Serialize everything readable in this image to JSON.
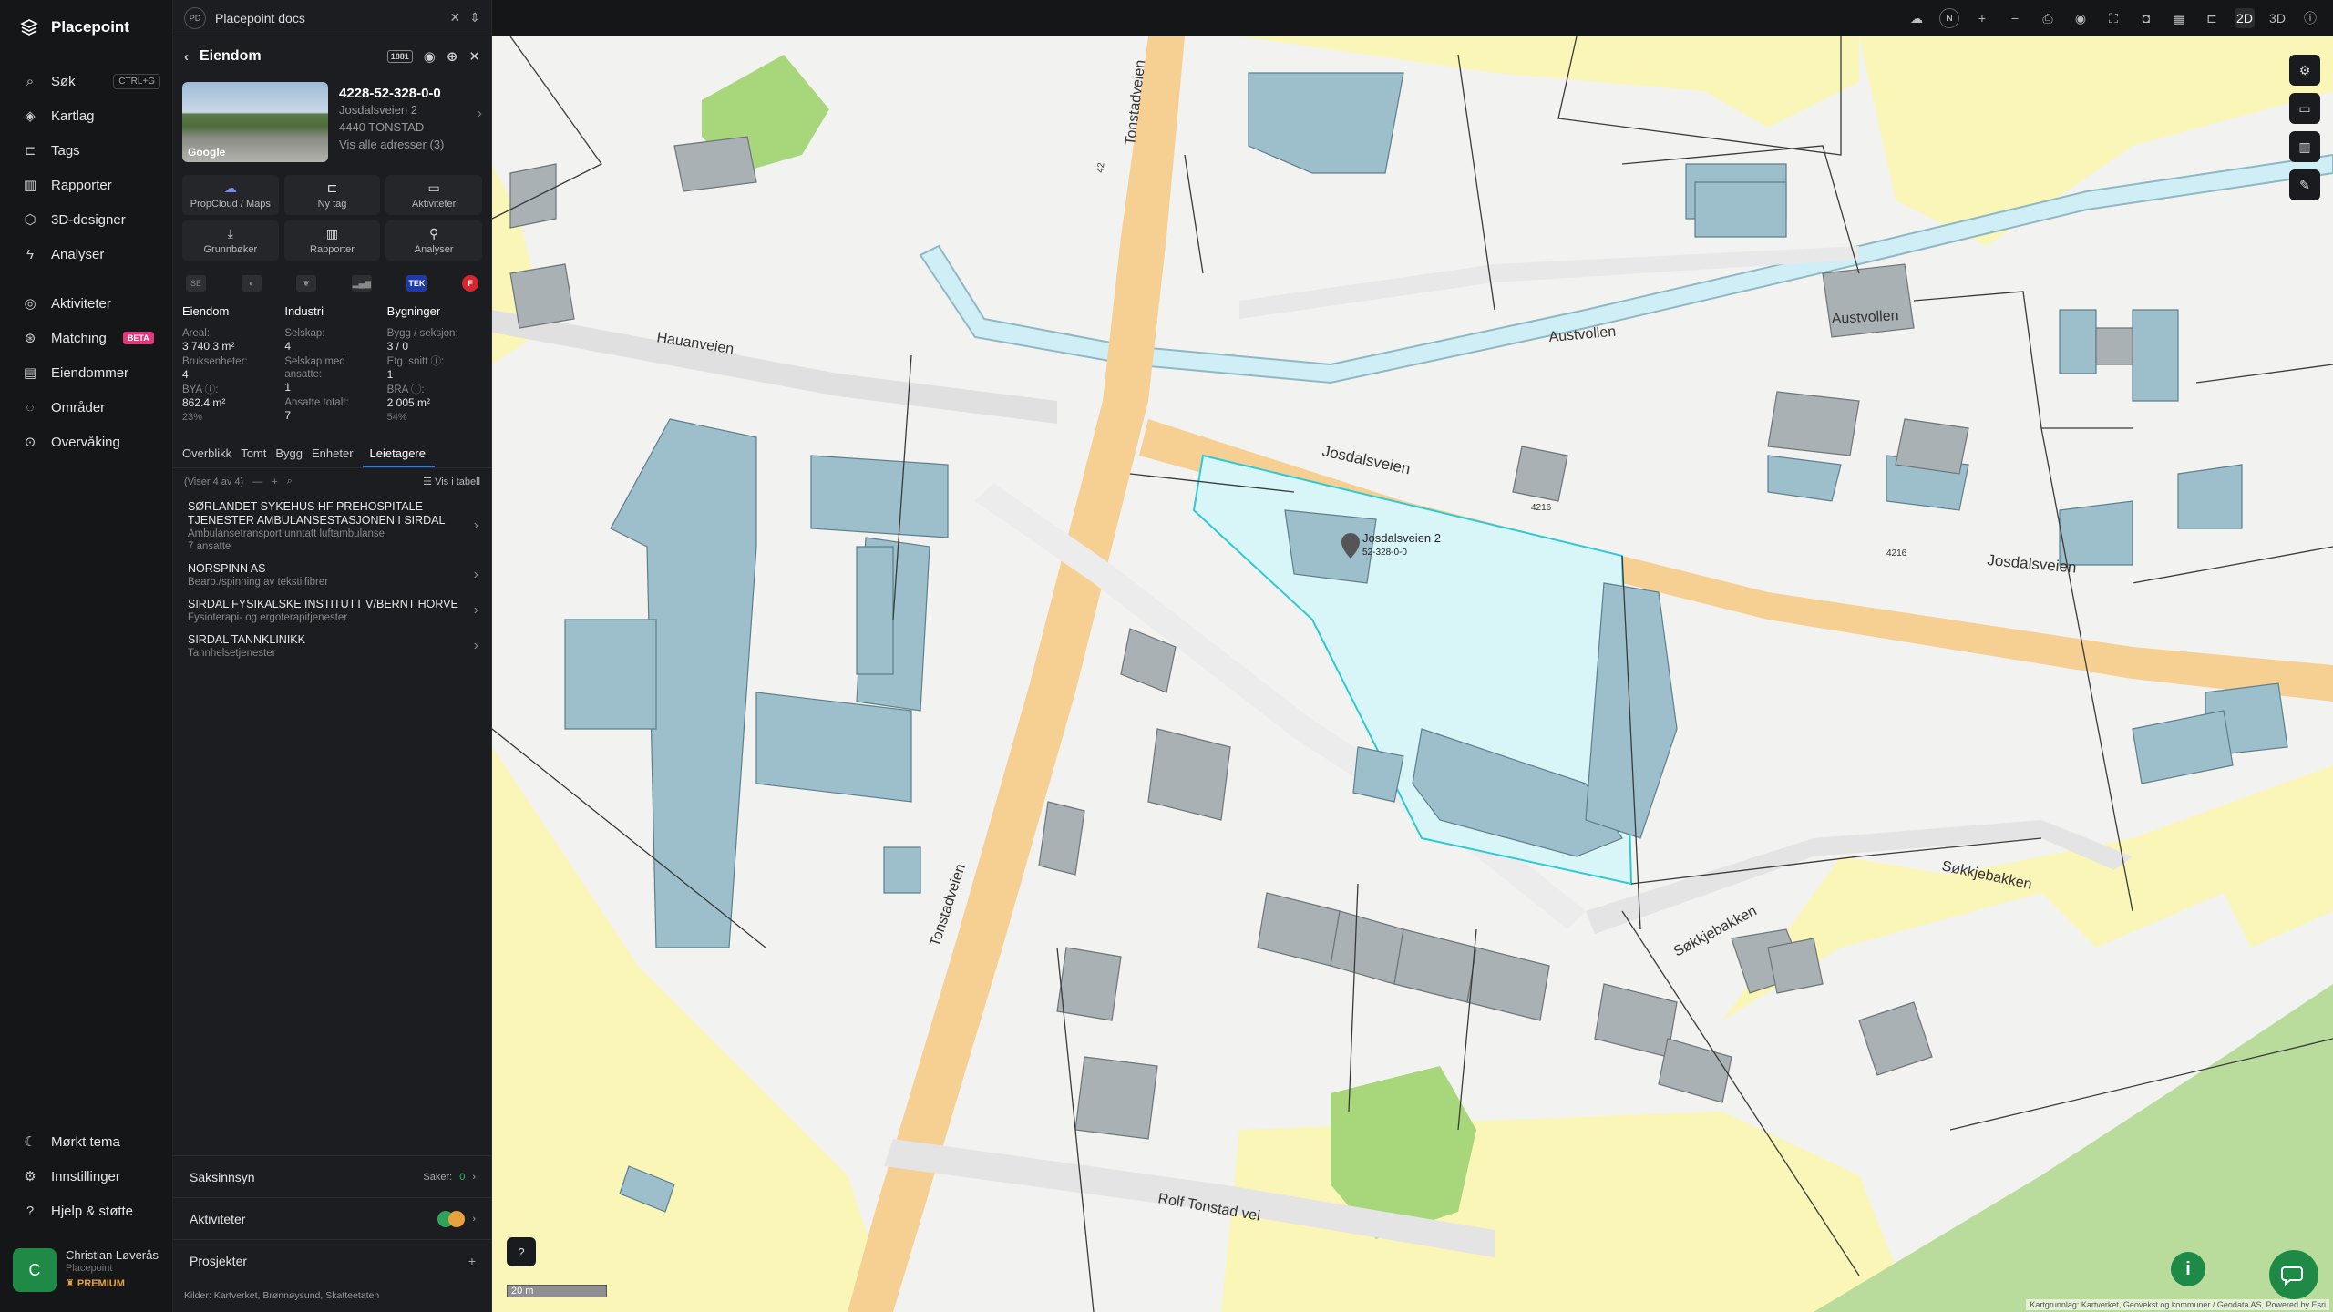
{
  "app": {
    "name": "Placepoint"
  },
  "nav": {
    "search": {
      "label": "Søk",
      "shortcut": "CTRL+G"
    },
    "items": [
      {
        "label": "Kartlag",
        "icon": "layers-icon"
      },
      {
        "label": "Tags",
        "icon": "bookmark-icon"
      },
      {
        "label": "Rapporter",
        "icon": "chart-icon"
      },
      {
        "label": "3D-designer",
        "icon": "cube-icon"
      },
      {
        "label": "Analyser",
        "icon": "bolt-icon"
      }
    ],
    "items2": [
      {
        "label": "Aktiviteter",
        "icon": "activity-icon"
      },
      {
        "label": "Matching",
        "icon": "matching-icon",
        "badge": "BETA"
      },
      {
        "label": "Eiendommer",
        "icon": "document-icon"
      },
      {
        "label": "Områder",
        "icon": "chat-icon"
      },
      {
        "label": "Overvåking",
        "icon": "target-icon"
      }
    ],
    "bottom": [
      {
        "label": "Mørkt tema",
        "icon": "moon-icon"
      },
      {
        "label": "Innstillinger",
        "icon": "gear-icon"
      },
      {
        "label": "Hjelp & støtte",
        "icon": "help-icon"
      }
    ],
    "user": {
      "initial": "C",
      "name": "Christian Løverås",
      "org": "Placepoint",
      "plan": "PREMIUM"
    }
  },
  "panel": {
    "docs_title": "Placepoint docs",
    "docs_badge": "PD",
    "header": "Eiendom",
    "header_badge": "1881",
    "property": {
      "id": "4228-52-328-0-0",
      "street": "Josdalsveien 2",
      "postal": "4440 TONSTAD",
      "all_addresses": "Vis alle adresser (3)",
      "photo_label": "Google"
    },
    "actions": [
      {
        "label": "PropCloud / Maps",
        "icon": "cloud-icon"
      },
      {
        "label": "Ny tag",
        "icon": "tag-icon"
      },
      {
        "label": "Aktiviteter",
        "icon": "activity-icon"
      },
      {
        "label": "Grunnbøker",
        "icon": "download-icon"
      },
      {
        "label": "Rapporter",
        "icon": "chart-icon"
      },
      {
        "label": "Analyser",
        "icon": "pin-icon"
      }
    ],
    "sources": [
      "SE",
      "◐",
      "❦",
      "▂▄▆",
      "TEK",
      "F"
    ],
    "stats": {
      "eiendom": {
        "title": "Eiendom",
        "areal_label": "Areal:",
        "areal": "3 740.3 m²",
        "bruks_label": "Bruksenheter:",
        "bruks": "4",
        "bya_label": "BYA ⓘ:",
        "bya": "862.4 m²",
        "bya_pct": "23%"
      },
      "industri": {
        "title": "Industri",
        "selskap_label": "Selskap:",
        "selskap": "4",
        "ansatte_label": "Selskap med ansatte:",
        "ansatte": "1",
        "tot_label": "Ansatte totalt:",
        "tot": "7"
      },
      "bygninger": {
        "title": "Bygninger",
        "bygg_label": "Bygg / seksjon:",
        "bygg": "3 / 0",
        "etg_label": "Etg. snitt ⓘ:",
        "etg": "1",
        "bra_label": "BRA ⓘ:",
        "bra": "2 005 m²",
        "bra_pct": "54%"
      }
    },
    "tabs": [
      "Overblikk",
      "Tomt",
      "Bygg",
      "Enheter",
      "Leietagere"
    ],
    "list_count": "(Viser 4 av 4)",
    "list_table": "Vis i tabell",
    "tenants": [
      {
        "name": "SØRLANDET SYKEHUS HF PREHOSPITALE TJENESTER AMBULANSESTASJONEN I SIRDAL",
        "sub": "Ambulansetransport unntatt luftambulanse",
        "extra": "7 ansatte"
      },
      {
        "name": "NORSPINN AS",
        "sub": "Bearb./spinning av tekstilfibrer",
        "extra": ""
      },
      {
        "name": "SIRDAL FYSIKALSKE INSTITUTT V/BERNT HORVE",
        "sub": "Fysioterapi- og ergoterapitjenester",
        "extra": ""
      },
      {
        "name": "SIRDAL TANNKLINIKK",
        "sub": "Tannhelsetjenester",
        "extra": ""
      }
    ],
    "saksinnsyn": {
      "label": "Saksinnsyn",
      "saker_label": "Saker:",
      "saker": "0"
    },
    "aktiviteter": {
      "label": "Aktiviteter"
    },
    "prosjekter": {
      "label": "Prosjekter"
    },
    "kilder": {
      "label": "Kilder:",
      "list": "Kartverket, Brønnøysund, Skatteetaten"
    }
  },
  "topbar": {
    "north": "N",
    "mode_2d": "2D",
    "mode_3d": "3D"
  },
  "map": {
    "scale": "20 m",
    "attribution": "Kartgrunnlag: Kartverket, Geovekst og kommuner / Geodata AS, Powered by Esri",
    "selected_label": "Josdalsveien 2",
    "selected_id": "52-328-0-0",
    "roads": [
      "Tonstadveien",
      "Josdalsveien",
      "Hauanveien",
      "Austvollen",
      "Søkkjebakken",
      "Rolf Tonstad vei"
    ],
    "road_number": "42",
    "road_number2": "4216"
  },
  "colors": {
    "accent": "#2f7fd8",
    "green": "#1f8a45",
    "building": "#9dbfcc",
    "selection": "#2ec9d6"
  }
}
